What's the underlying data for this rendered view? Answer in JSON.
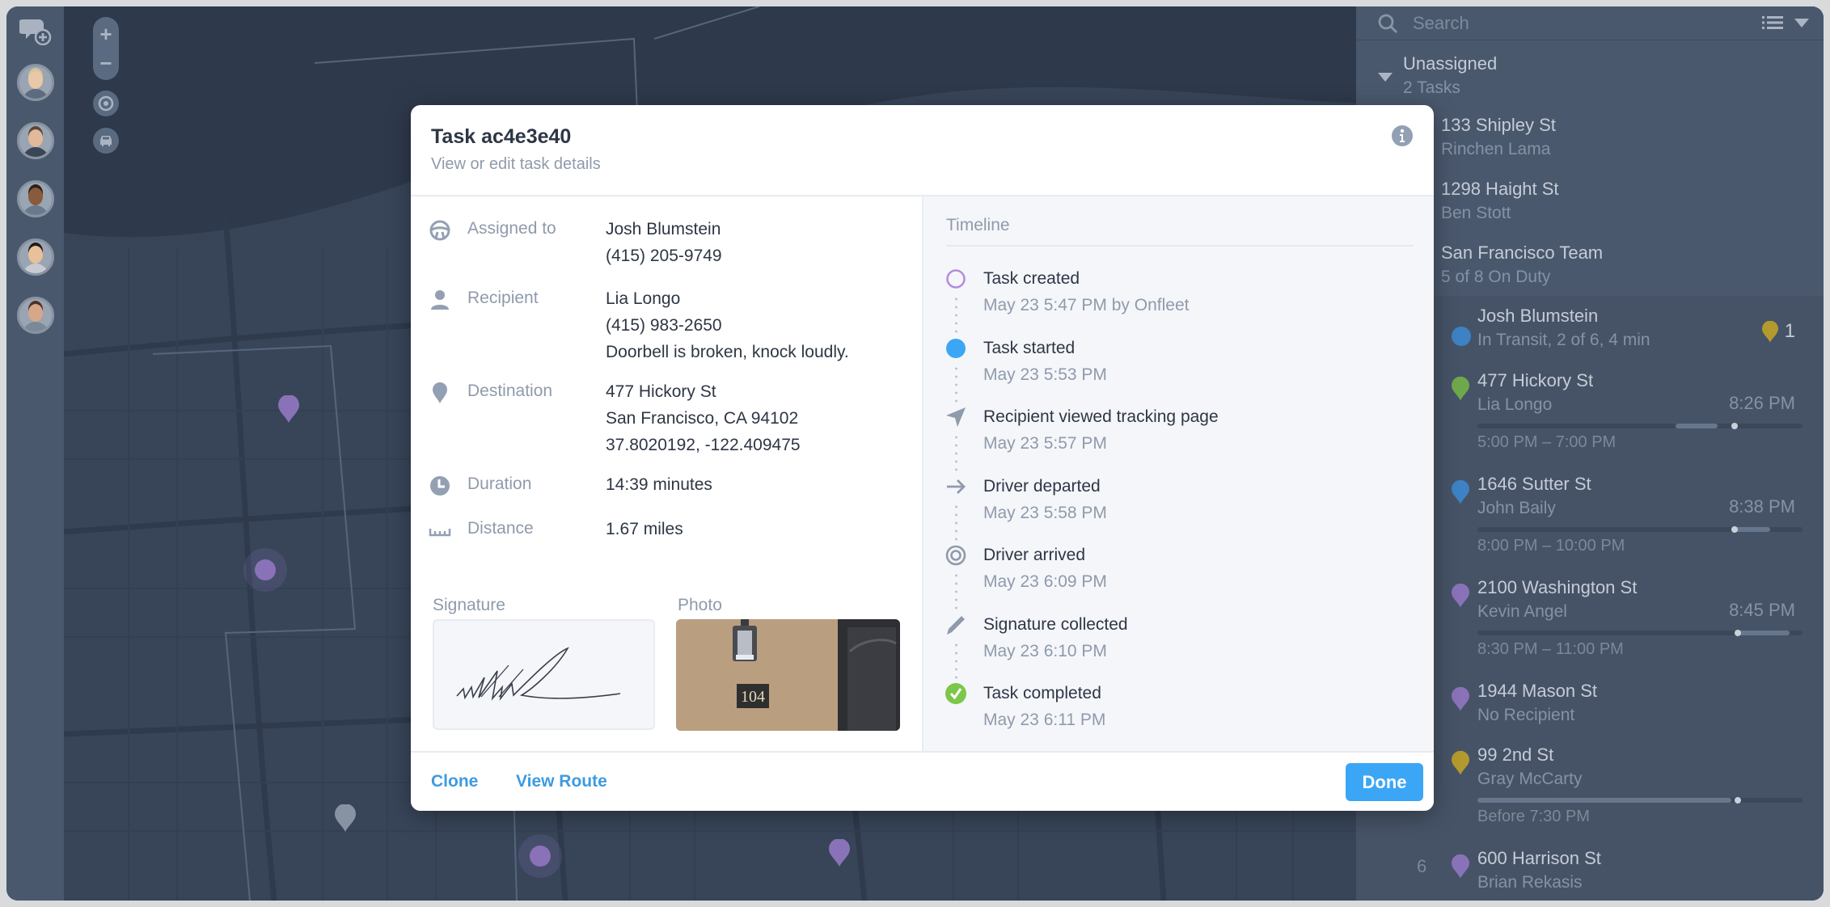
{
  "sidebar": {
    "new_chat_icon": "chat-add-icon",
    "avatars": [
      {
        "label": "driver-1",
        "skin": "#e8c8a8",
        "shirt": "#5d6b7e",
        "hair": "#d8c49a"
      },
      {
        "label": "driver-2",
        "skin": "#e2b99a",
        "shirt": "#3a4556",
        "hair": "#5a4636"
      },
      {
        "label": "driver-3",
        "skin": "#8a5a3c",
        "shirt": "#6a7a8e",
        "hair": "#2a1f1a"
      },
      {
        "label": "driver-4",
        "skin": "#e8c09a",
        "shirt": "#c8ccd2",
        "hair": "#1e1a18"
      },
      {
        "label": "driver-5",
        "skin": "#d6a888",
        "shirt": "#7a8898",
        "hair": "#4a3428"
      }
    ]
  },
  "map": {
    "controls": {
      "zoom_in": "+",
      "zoom_out": "−",
      "locate_icon": "target-icon",
      "vehicle_icon": "car-icon"
    },
    "pin_color_purple": "#8a72b8",
    "pin_color_gray": "#8793a3"
  },
  "modal": {
    "title": "Task ac4e3e40",
    "subtitle": "View or edit task details",
    "details": [
      {
        "icon": "steering-wheel-icon",
        "label": "Assigned to",
        "values": [
          "Josh Blumstein",
          "(415) 205-9749"
        ]
      },
      {
        "icon": "person-icon",
        "label": "Recipient",
        "values": [
          "Lia Longo",
          "(415) 983-2650",
          "Doorbell is broken, knock loudly."
        ]
      },
      {
        "icon": "location-pin-icon",
        "label": "Destination",
        "values": [
          "477 Hickory St",
          "San Francisco, CA 94102",
          "37.8020192, -122.409475"
        ]
      },
      {
        "icon": "clock-icon",
        "label": "Duration",
        "values": [
          "14:39 minutes"
        ]
      },
      {
        "icon": "ruler-icon",
        "label": "Distance",
        "values": [
          "1.67 miles"
        ]
      }
    ],
    "signature_label": "Signature",
    "photo_label": "Photo",
    "photo_number": "104",
    "timeline_title": "Timeline",
    "timeline": [
      {
        "icon": "circle-outline-icon",
        "title": "Task created",
        "time": "May 23 5:47 PM by Onfleet",
        "color": "#b38be0"
      },
      {
        "icon": "filled-circle-icon",
        "title": "Task started",
        "time": "May 23 5:53 PM",
        "color": "#3ba6f5"
      },
      {
        "icon": "navigation-arrow-icon",
        "title": "Recipient viewed tracking page",
        "time": "May 23 5:57 PM",
        "color": "#8f9aab"
      },
      {
        "icon": "arrow-right-icon",
        "title": "Driver departed",
        "time": "May 23 5:58 PM",
        "color": "#8f9aab"
      },
      {
        "icon": "target-icon",
        "title": "Driver arrived",
        "time": "May 23 6:09 PM",
        "color": "#8f9aab"
      },
      {
        "icon": "pen-icon",
        "title": "Signature collected",
        "time": "May 23 6:10 PM",
        "color": "#8f9aab"
      },
      {
        "icon": "check-circle-icon",
        "title": "Task completed",
        "time": "May 23 6:11 PM",
        "color": "#7cc74a"
      }
    ],
    "footer": {
      "clone": "Clone",
      "view_route": "View Route",
      "done": "Done"
    }
  },
  "panel": {
    "search_placeholder": "Search",
    "unassigned": {
      "title": "Unassigned",
      "count": "2 Tasks"
    },
    "unassigned_tasks": [
      {
        "address": "133 Shipley St",
        "recipient": "Rinchen Lama"
      },
      {
        "address": "1298 Haight St",
        "recipient": "Ben Stott"
      }
    ],
    "team": {
      "name": "San Francisco Team",
      "status": "5 of 8 On Duty"
    },
    "driver": {
      "name": "Josh Blumstein",
      "status": "In Transit, 2 of 6, 4 min",
      "badge_count": "1",
      "badge_color": "#b39a2e",
      "dot_color": "#3d82c4"
    },
    "driver_tasks": [
      {
        "address": "477 Hickory St",
        "recipient": "Lia Longo",
        "eta": "8:26 PM",
        "window": "5:00 PM – 7:00 PM",
        "pin_color": "#6fa84a",
        "bar": {
          "win_start": 0.61,
          "win_end": 0.74,
          "now": 0.79
        }
      },
      {
        "address": "1646 Sutter St",
        "recipient": "John Baily",
        "eta": "8:38 PM",
        "window": "8:00 PM – 10:00 PM",
        "pin_color": "#3d82c4",
        "bar": {
          "win_start": 0.78,
          "win_end": 0.9,
          "now": 0.79
        }
      },
      {
        "address": "2100 Washington St",
        "recipient": "Kevin Angel",
        "eta": "8:45 PM",
        "window": "8:30 PM – 11:00 PM",
        "pin_color": "#8a72b8",
        "bar": {
          "win_start": 0.8,
          "win_end": 0.96,
          "now": 0.8
        }
      },
      {
        "address": "1944 Mason St",
        "recipient": "No Recipient",
        "eta": "",
        "window": "",
        "pin_color": "#8a72b8",
        "bar": null
      },
      {
        "address": "99 2nd St",
        "recipient": "Gray McCarty",
        "eta": "",
        "window": "Before 7:30 PM",
        "pin_color": "#b39a2e",
        "bar": {
          "win_start": 0.0,
          "win_end": 0.78,
          "now": 0.8
        }
      },
      {
        "address": "600 Harrison St",
        "recipient": "Brian Rekasis",
        "eta": "",
        "window": "",
        "pin_color": "#8a72b8",
        "bar": null,
        "index": "6"
      }
    ]
  }
}
